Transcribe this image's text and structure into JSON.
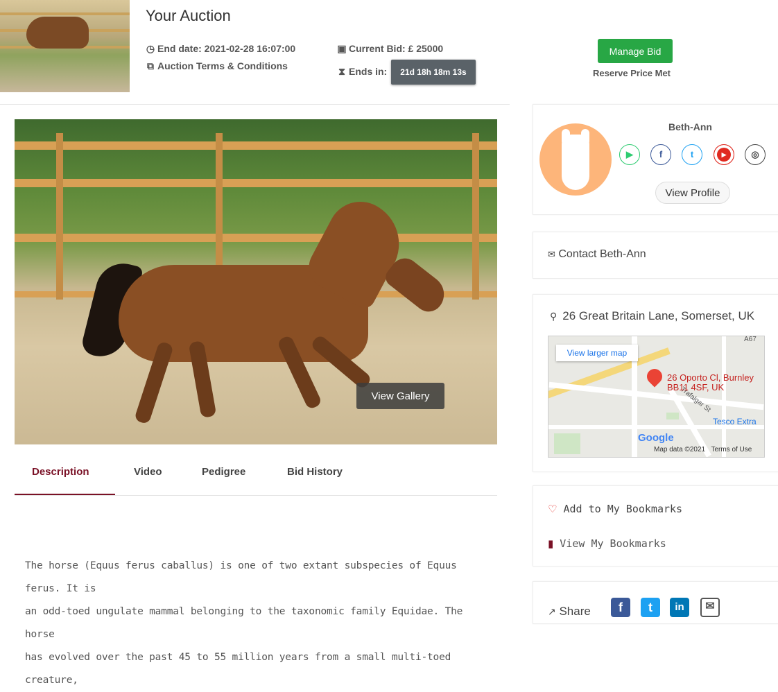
{
  "header": {
    "title": "Your Auction",
    "end_date": "End date: 2021-02-28 16:07:00",
    "terms_link": "Auction Terms & Conditions",
    "current_bid": "Current Bid: £ 25000",
    "ends_in_label": "Ends in:",
    "countdown": "21d 18h 18m 13s",
    "manage_bid": "Manage Bid",
    "reserve_status": "Reserve Price Met"
  },
  "gallery": {
    "button": "View Gallery"
  },
  "tabs": [
    {
      "label": "Description",
      "active": true
    },
    {
      "label": "Video",
      "active": false
    },
    {
      "label": "Pedigree",
      "active": false
    },
    {
      "label": "Bid History",
      "active": false
    }
  ],
  "description": {
    "lines": [
      "The horse (Equus ferus caballus) is one of two extant subspecies of Equus ferus. It is",
      "an odd-toed ungulate mammal belonging to the taxonomic family Equidae. The horse",
      "has evolved over the past 45 to 55 million years from a small multi-toed creature,"
    ]
  },
  "seller": {
    "name": "Beth-Ann",
    "view_profile": "View Profile",
    "socials": [
      "play-icon",
      "facebook-icon",
      "twitter-icon",
      "youtube-icon",
      "instagram-icon"
    ]
  },
  "contact": {
    "label": "Contact Beth-Ann"
  },
  "location": {
    "address": "26 Great Britain Lane, Somerset, UK",
    "map": {
      "view_larger": "View larger map",
      "pin_line1": "26 Oporto Cl, Burnley",
      "pin_line2": "BB11 4SF, UK",
      "poi": "Tesco Extra",
      "road_label": "Trafalgar St",
      "road_label_2": "A67",
      "brand": "Google",
      "data_credit": "Map data ©2021",
      "terms": "Terms of Use"
    }
  },
  "bookmarks": {
    "add": "Add to My Bookmarks",
    "view": "View My Bookmarks"
  },
  "share": {
    "label": "Share"
  },
  "colors": {
    "accent": "#7a1126",
    "manage_bid": "#28a745",
    "countdown_bg": "#5a6268",
    "avatar_bg": "#fdb57a"
  }
}
